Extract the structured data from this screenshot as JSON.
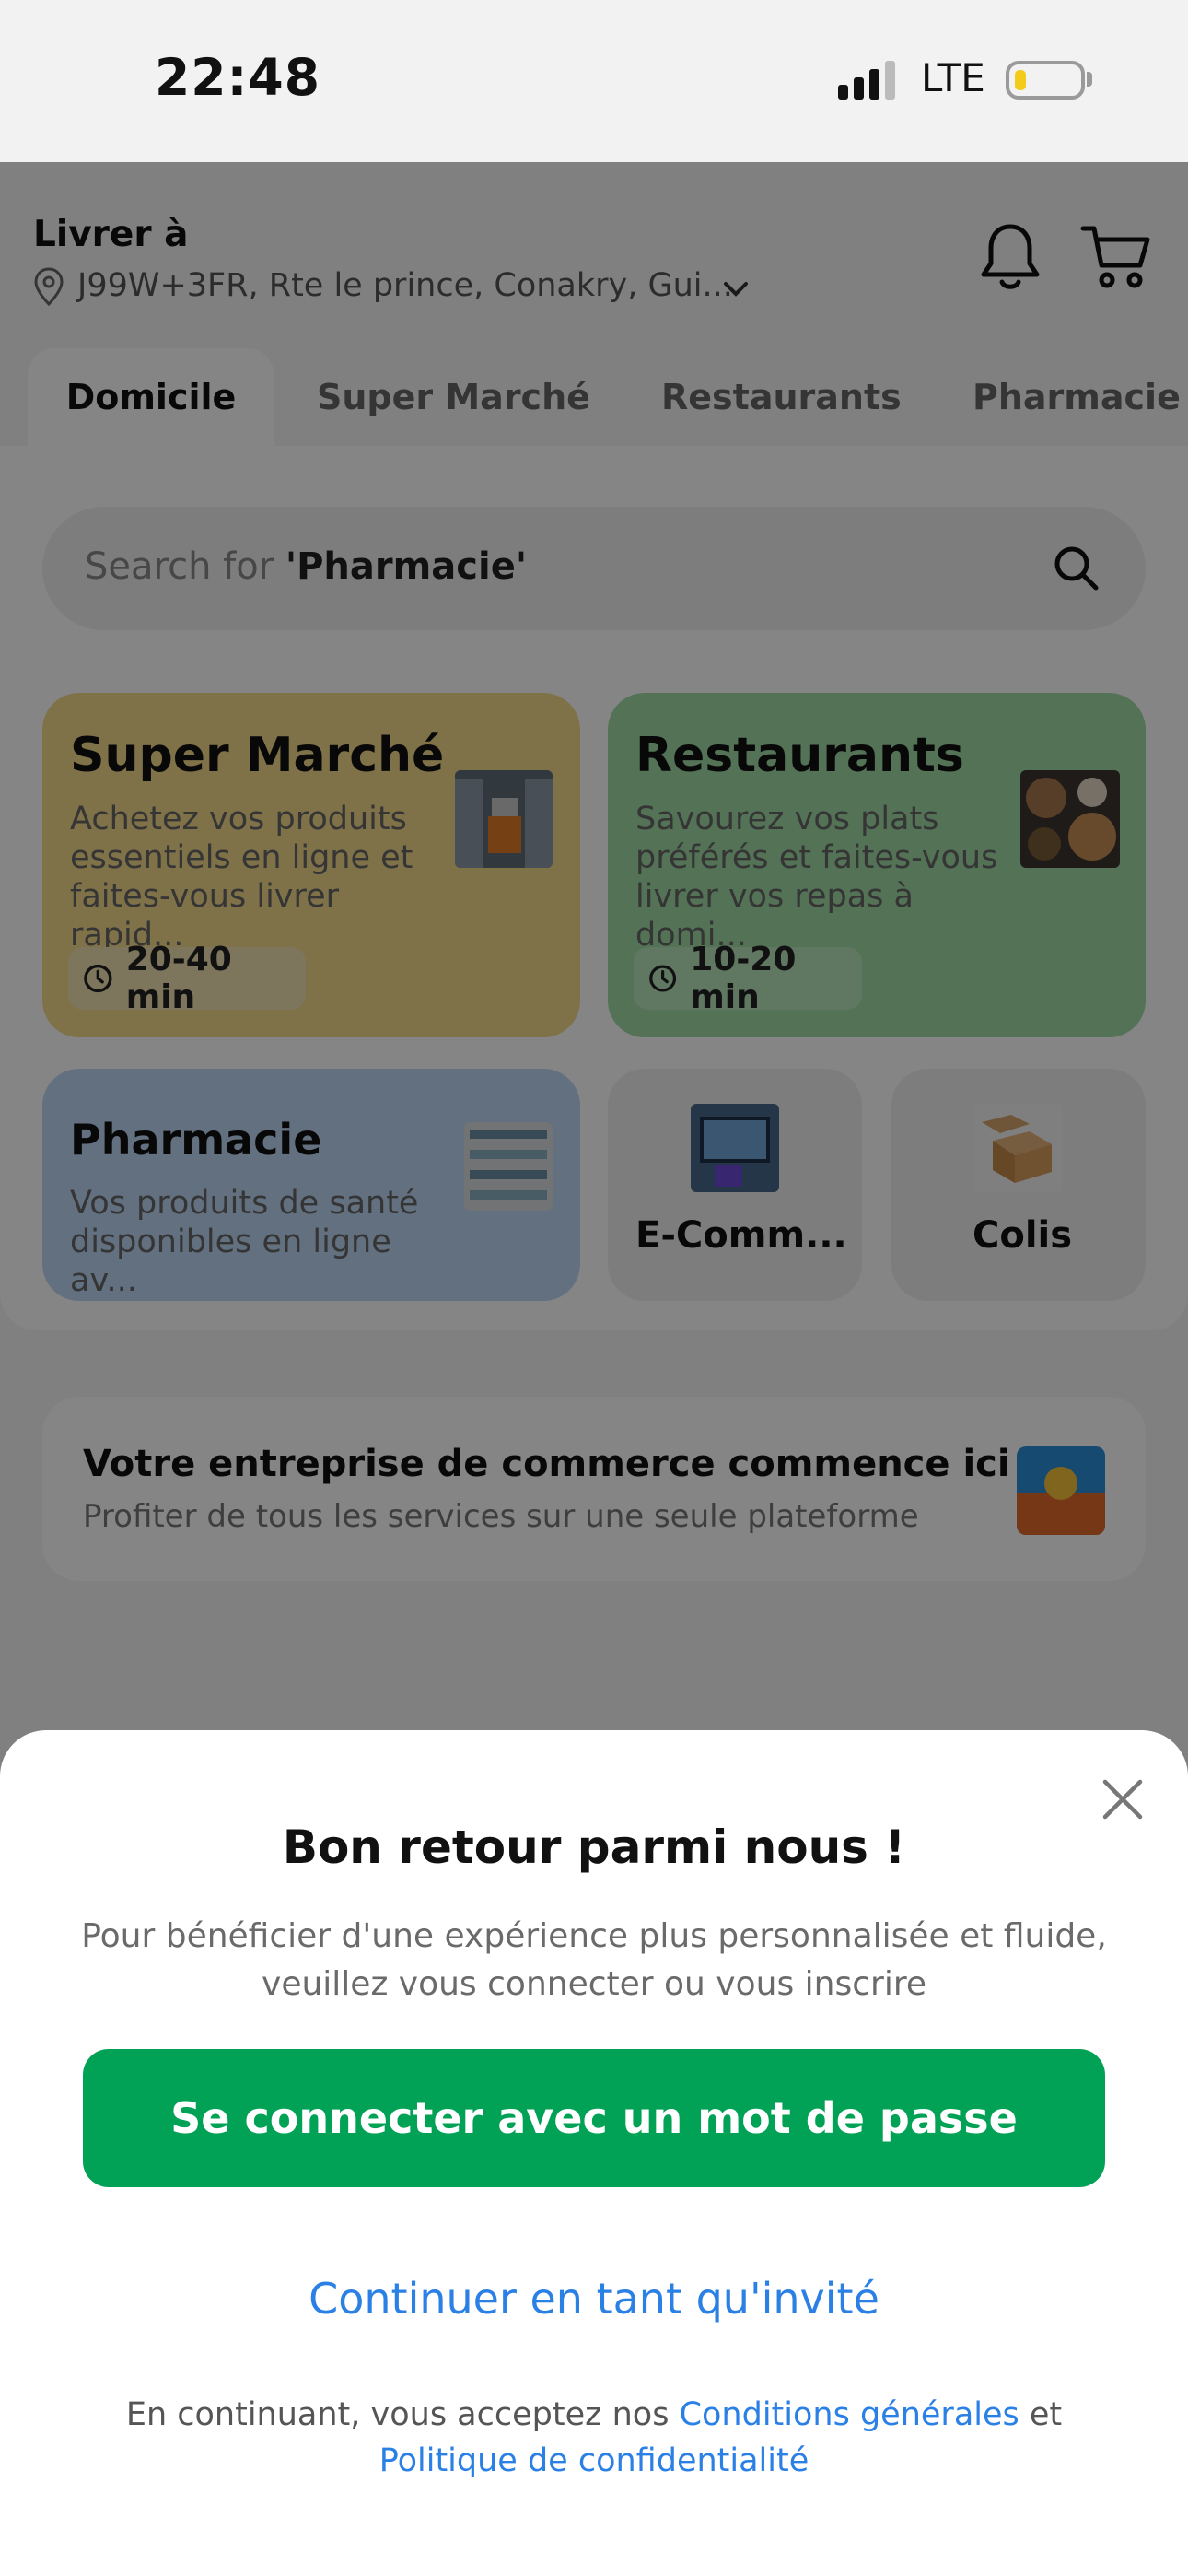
{
  "status_bar": {
    "time": "22:48",
    "network": "LTE",
    "battery_level": 0.15
  },
  "header": {
    "deliver_label": "Livrer à",
    "address": "J99W+3FR, Rte le prince, Conakry, Gui...",
    "icons": [
      "location-pin-icon",
      "chevron-down-icon",
      "bell-icon",
      "cart-icon"
    ]
  },
  "tabs": [
    {
      "label": "Domicile",
      "active": true
    },
    {
      "label": "Super Marché",
      "active": false
    },
    {
      "label": "Restaurants",
      "active": false
    },
    {
      "label": "Pharmacie",
      "active": false
    }
  ],
  "search": {
    "prefix": "Search for ",
    "highlight": "'Pharmacie'"
  },
  "cards": {
    "supermarche": {
      "title": "Super Marché",
      "desc": "Achetez vos produits essentiels en ligne et faites-vous livrer rapid...",
      "time": "20-40 min",
      "color": "#f4d88a"
    },
    "restaurants": {
      "title": "Restaurants",
      "desc": "Savourez vos plats préférés et faites-vous livrer vos repas à domi...",
      "time": "10-20 min",
      "color": "#9fdba6"
    },
    "pharmacie": {
      "title": "Pharmacie",
      "desc": "Vos produits de santé disponibles en ligne av...",
      "color": "#bfd6f5"
    },
    "ecommerce": {
      "title": "E-Comm..."
    },
    "colis": {
      "title": "Colis"
    }
  },
  "promo": {
    "title": "Votre entreprise de commerce commence ici",
    "subtitle": "Profiter de tous les services sur une seule plateforme"
  },
  "sheet": {
    "title": "Bon retour parmi nous !",
    "message": "Pour bénéficier d'une expérience plus personnalisée et fluide, veuillez vous connecter ou vous inscrire",
    "login_button": "Se connecter avec un mot de passe",
    "guest_link": "Continuer en tant qu'invité",
    "legal_prefix": "En continuant, vous acceptez nos ",
    "terms_link": "Conditions générales",
    "legal_and": " et",
    "privacy_link": "Politique de confidentialité"
  },
  "colors": {
    "accent_green": "#01a256",
    "link_blue": "#2b80e6"
  }
}
